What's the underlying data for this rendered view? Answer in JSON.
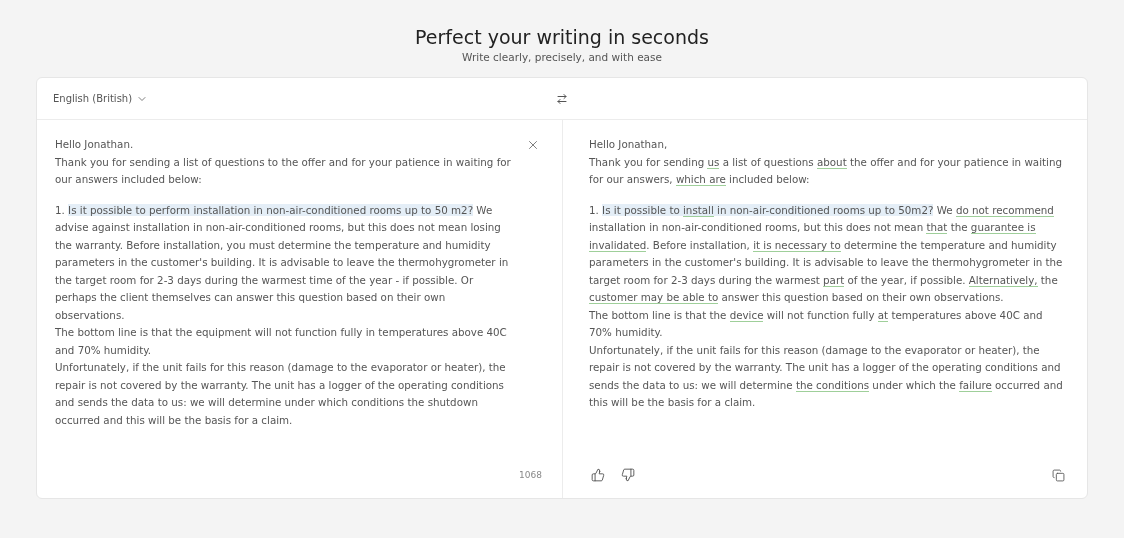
{
  "header": {
    "title": "Perfect your writing in seconds",
    "subtitle": "Write clearly, precisely, and with ease"
  },
  "toolbar": {
    "language": "English (British)"
  },
  "input": {
    "blocks": [
      [
        [
          {
            "kind": "plain",
            "text": "Hello Jonathan."
          }
        ],
        [
          {
            "kind": "plain",
            "text": "Thank you for sending a list of questions to the offer and for your patience in waiting for our answers included below:"
          }
        ]
      ],
      [
        [
          {
            "kind": "plain",
            "text": "1. "
          },
          {
            "kind": "highlight",
            "text": "Is it possible to perform installation in non-air-conditioned rooms up to 50 m2?"
          },
          {
            "kind": "plain",
            "text": " We advise against installation in non-air-conditioned rooms, but this does not mean losing the warranty. Before installation, you must determine the temperature and humidity parameters in the customer's building. It is advisable to leave the thermohygrometer in the target room for 2-3 days during the warmest time of the year - if possible. Or perhaps the client themselves can answer this question based on their own observations."
          }
        ],
        [
          {
            "kind": "plain",
            "text": "The bottom line is that the equipment will not function fully in temperatures above 40C and 70% humidity."
          }
        ],
        [
          {
            "kind": "plain",
            "text": "Unfortunately, if the unit fails for this reason (damage to the evaporator or heater), the repair is not covered by the warranty. The unit has a logger of the operating conditions and sends the data to us: we will determine under which conditions the shutdown occurred and this will be the basis for a claim."
          }
        ]
      ]
    ],
    "count": "1068"
  },
  "output": {
    "blocks": [
      [
        [
          {
            "kind": "plain",
            "text": "Hello Jonathan,"
          }
        ],
        [
          {
            "kind": "plain",
            "text": "Thank you for sending "
          },
          {
            "kind": "changed",
            "text": "us"
          },
          {
            "kind": "plain",
            "text": " a list of questions "
          },
          {
            "kind": "changed",
            "text": "about"
          },
          {
            "kind": "plain",
            "text": " the offer and for your patience in waiting for our answers, "
          },
          {
            "kind": "changed",
            "text": "which are"
          },
          {
            "kind": "plain",
            "text": " included below:"
          }
        ]
      ],
      [
        [
          {
            "kind": "plain",
            "text": "1. "
          },
          {
            "kind": "highlight",
            "text": "Is it possible to "
          },
          {
            "kind": "highlight-changed",
            "text": "install"
          },
          {
            "kind": "highlight",
            "text": " in non-air-conditioned rooms up to 50m2?"
          },
          {
            "kind": "plain",
            "text": " We "
          },
          {
            "kind": "changed",
            "text": "do not recommend"
          },
          {
            "kind": "plain",
            "text": " installation in non-air-conditioned rooms, but this does not mean "
          },
          {
            "kind": "changed",
            "text": "that"
          },
          {
            "kind": "plain",
            "text": " the "
          },
          {
            "kind": "changed",
            "text": "guarantee is invalidated"
          },
          {
            "kind": "plain",
            "text": ". Before installation, "
          },
          {
            "kind": "changed",
            "text": "it is necessary to"
          },
          {
            "kind": "plain",
            "text": " determine the temperature and humidity parameters in the customer's building. It is advisable to leave the thermohygrometer in the target room for 2-3 days during the warmest "
          },
          {
            "kind": "changed",
            "text": "part"
          },
          {
            "kind": "plain",
            "text": " of the year, if possible. "
          },
          {
            "kind": "changed",
            "text": "Alternatively,"
          },
          {
            "kind": "plain",
            "text": " the "
          },
          {
            "kind": "changed",
            "text": "customer may be able to"
          },
          {
            "kind": "plain",
            "text": " answer this question based on their own observations."
          }
        ],
        [
          {
            "kind": "plain",
            "text": "The bottom line is that the "
          },
          {
            "kind": "changed",
            "text": "device"
          },
          {
            "kind": "plain",
            "text": " will not function fully "
          },
          {
            "kind": "changed",
            "text": "at"
          },
          {
            "kind": "plain",
            "text": " temperatures above 40C and 70% humidity."
          }
        ],
        [
          {
            "kind": "plain",
            "text": "Unfortunately, if the unit fails for this reason (damage to the evaporator or heater), the repair is not covered by the warranty. The unit has a logger of the operating conditions and sends the data to us: we will determine "
          },
          {
            "kind": "changed",
            "text": "the conditions"
          },
          {
            "kind": "plain",
            "text": " under which the "
          },
          {
            "kind": "changed",
            "text": "failure"
          },
          {
            "kind": "plain",
            "text": " occurred and this will be the basis for a claim."
          }
        ]
      ]
    ]
  }
}
